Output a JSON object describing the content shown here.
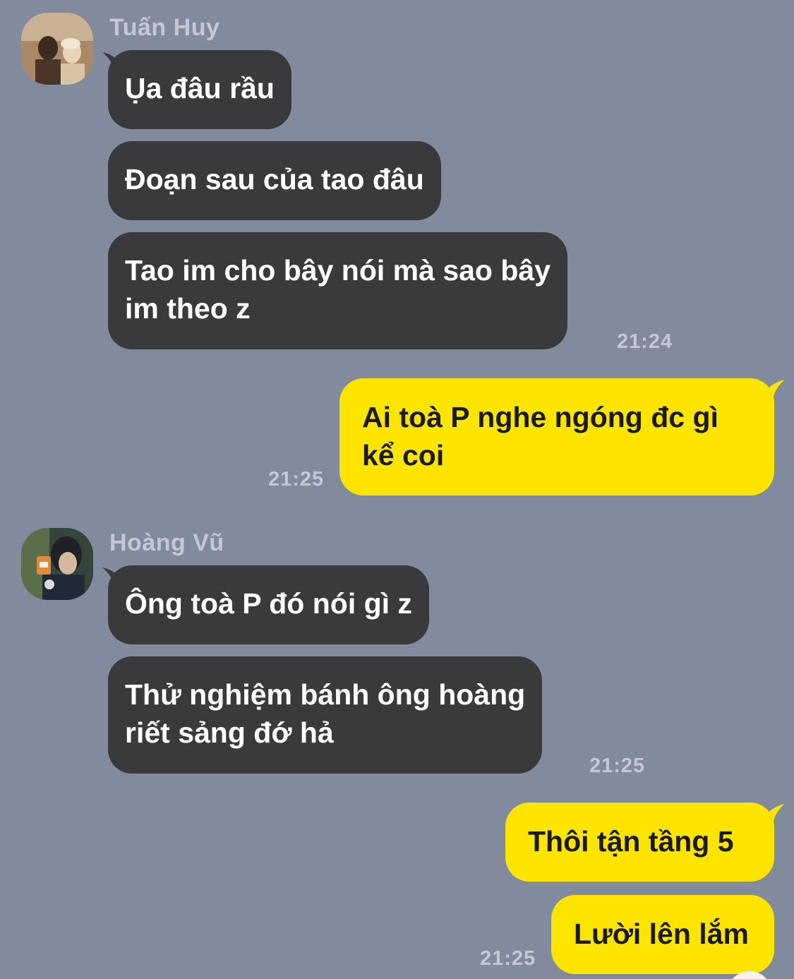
{
  "colors": {
    "background": "#818b9d",
    "incoming_bubble": "#3a3a3c",
    "outgoing_bubble": "#fee500",
    "meta_text": "#c3c8d2"
  },
  "messages": {
    "g1": {
      "sender": "Tuấn Huy",
      "m1": "Ụa đâu rầu",
      "m2": "Đoạn sau của tao đâu",
      "m3": "Tao im cho bây nói mà sao bây\nim theo z",
      "time": "21:24"
    },
    "out1": {
      "m1": "Ai toà P nghe ngóng đc gì\nkể coi",
      "time": "21:25"
    },
    "g2": {
      "sender": "Hoàng Vũ",
      "m1": "Ông toà P đó nói gì z",
      "m2": "Thử nghiệm bánh ông hoàng\nriết sảng đớ hả",
      "time": "21:25"
    },
    "out2": {
      "m1": "Thôi tận tầng 5",
      "m2": "Lười lên lắm",
      "time": "21:25"
    }
  }
}
